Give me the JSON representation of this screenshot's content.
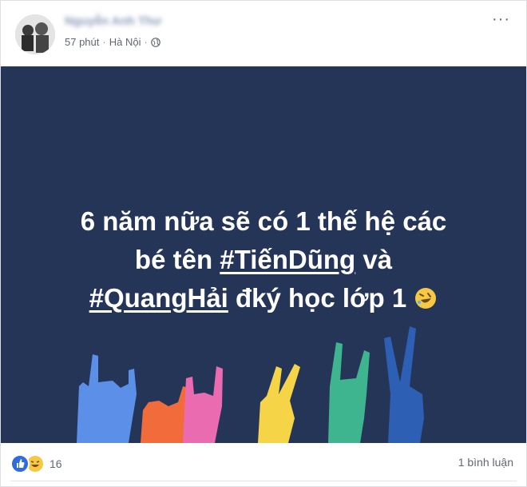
{
  "post": {
    "author": "Nguyễn Anh Thư",
    "time": "57 phút",
    "separator": "·",
    "location": "Hà Nội",
    "privacy_icon": "globe-icon",
    "more_label": "···"
  },
  "image": {
    "background": "#253558",
    "line1": "6 năm nữa sẽ có 1 thế hệ các",
    "line2_prefix": "bé tên ",
    "line2_tag": "#TiếnDũng",
    "line2_suffix": " và",
    "line3_tag": "#QuangHải",
    "line3_suffix": " đký học lớp 1",
    "emoji": "rolling-on-floor-laughing-emoji",
    "hand_colors": [
      "#5b8fe8",
      "#f26b3a",
      "#ea6bb0",
      "#f5d547",
      "#3fb58f",
      "#2d5fb4"
    ]
  },
  "footer": {
    "reaction_count": "16",
    "reaction_icons": [
      "like-icon",
      "haha-icon"
    ],
    "comments": "1 bình luận"
  }
}
